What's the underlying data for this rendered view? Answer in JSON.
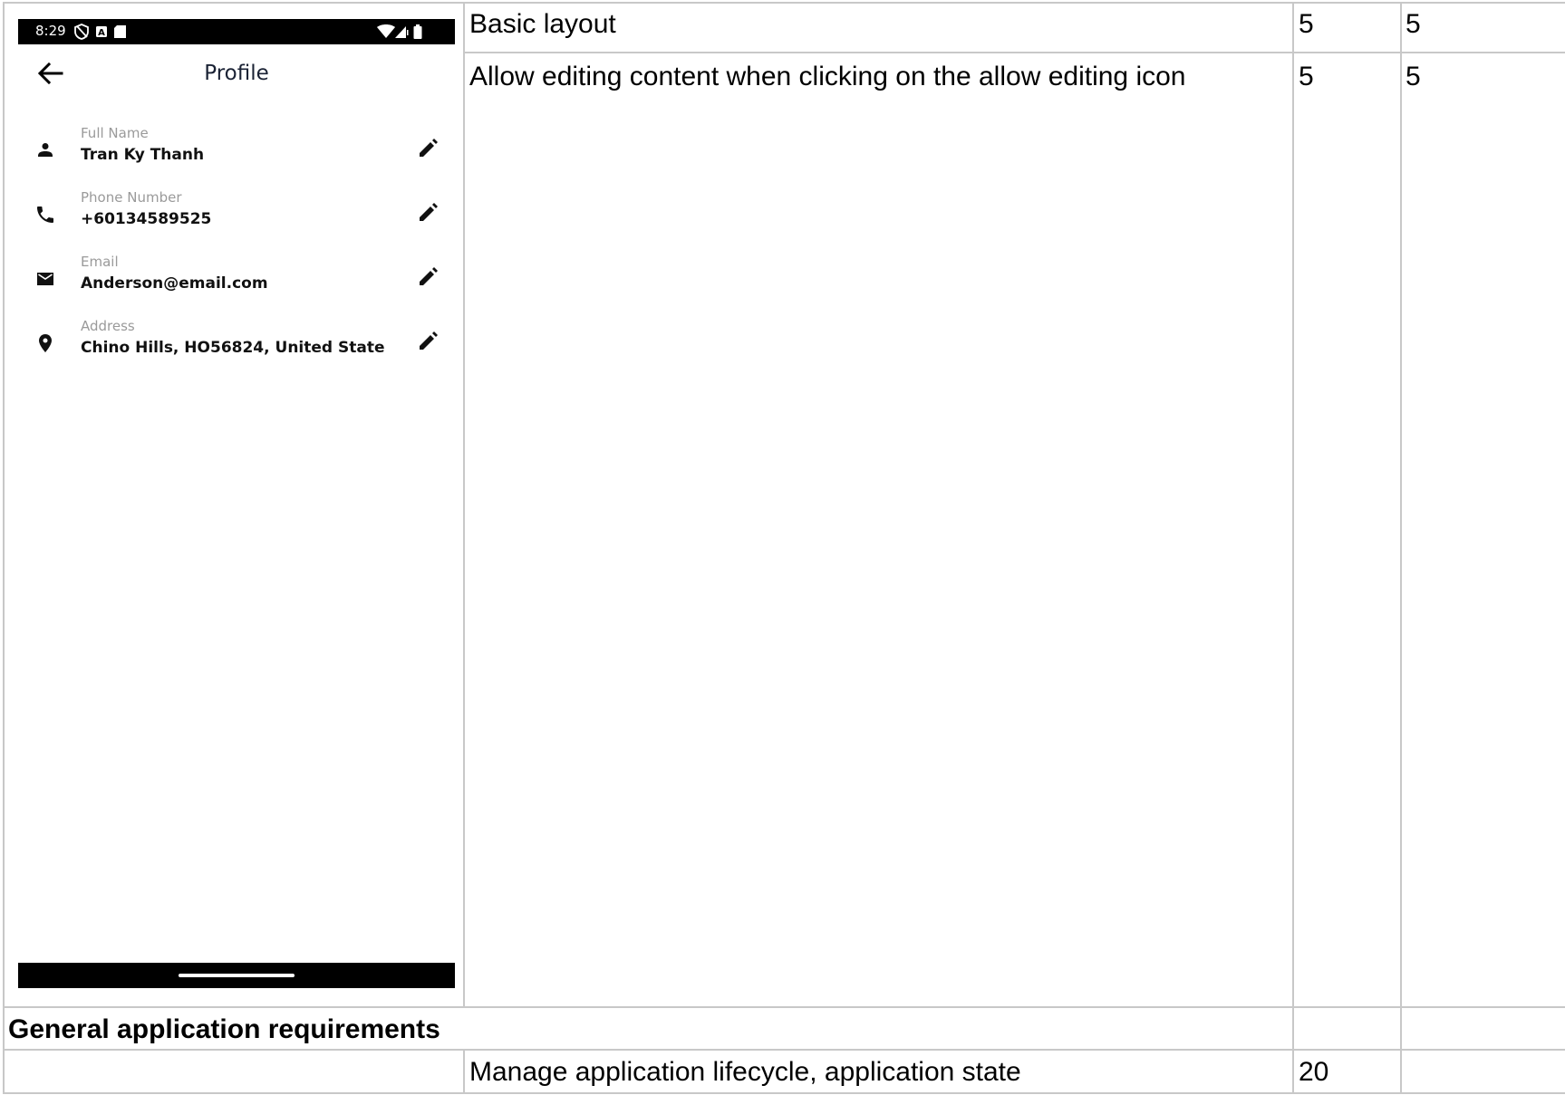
{
  "phone": {
    "status_bar": {
      "time": "8:29",
      "left_icons": [
        "shield-icon",
        "a-icon",
        "sd-card-icon"
      ],
      "right_icons": [
        "wifi-icon",
        "signal-icon",
        "battery-icon"
      ]
    },
    "app_bar": {
      "back_icon": "arrow-back-icon",
      "title": "Profile"
    },
    "fields": [
      {
        "icon": "person-icon",
        "label": "Full Name",
        "value": "Tran Ky Thanh",
        "edit_icon": "pencil-icon"
      },
      {
        "icon": "phone-icon",
        "label": "Phone Number",
        "value": "+60134589525",
        "edit_icon": "pencil-icon"
      },
      {
        "icon": "mail-icon",
        "label": "Email",
        "value": "Anderson@email.com",
        "edit_icon": "pencil-icon"
      },
      {
        "icon": "location-pin-icon",
        "label": "Address",
        "value": "Chino Hills, HO56824, United State",
        "edit_icon": "pencil-icon"
      }
    ],
    "colors": {
      "title": "#1a2234",
      "label": "#9a9a9a",
      "bars": "#000000"
    }
  },
  "table": {
    "rows": [
      {
        "requirement": "Basic layout",
        "col3": "5",
        "col4": "5"
      },
      {
        "requirement": "Allow editing content when clicking on the allow editing icon",
        "col3": "5",
        "col4": "5"
      }
    ],
    "section_heading": "General application requirements",
    "section_rows": [
      {
        "requirement": "Manage application lifecycle, application state",
        "col3": "20",
        "col4": ""
      }
    ],
    "grid_color": "#c8c8c8"
  }
}
